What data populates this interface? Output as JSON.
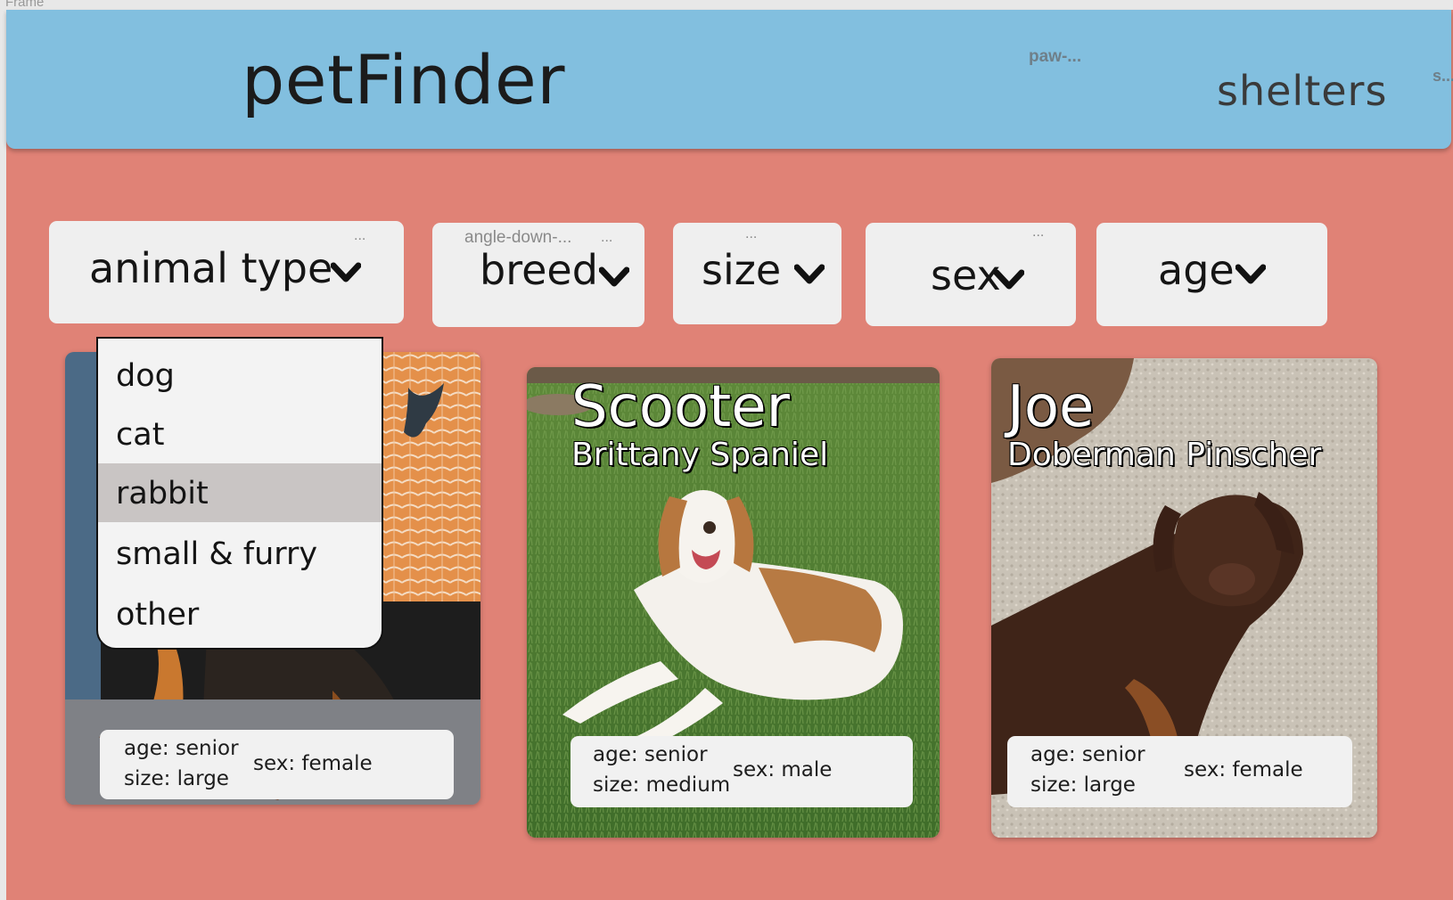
{
  "frame": {
    "label": "Frame"
  },
  "header": {
    "logo": "petFinder",
    "paw_label": "paw-...",
    "nav_shelters": "shelters",
    "s_label": "s..."
  },
  "filters": [
    {
      "label": "animal type",
      "icon": "chevron-down-icon",
      "dots": "...",
      "hint": ""
    },
    {
      "label": "breed",
      "icon": "chevron-down-icon",
      "dots": "...",
      "hint": "angle-down-..."
    },
    {
      "label": "size",
      "icon": "chevron-down-icon",
      "dots": "...",
      "hint": ""
    },
    {
      "label": "sex",
      "icon": "chevron-down-icon",
      "dots": "...",
      "hint": ""
    },
    {
      "label": "age",
      "icon": "chevron-down-icon",
      "dots": "",
      "hint": ""
    }
  ],
  "animal_type_dropdown": {
    "options": [
      "dog",
      "cat",
      "rabbit",
      "small & furry",
      "other"
    ],
    "highlighted": "rabbit"
  },
  "pets": [
    {
      "name": "",
      "breed": "",
      "age": "age: senior",
      "size": "size: large",
      "sex": "sex: female"
    },
    {
      "name": "Scooter",
      "breed": "Brittany Spaniel",
      "age": "age: senior",
      "size": "size: medium",
      "sex": "sex: male"
    },
    {
      "name": "Joe",
      "breed": "Doberman Pinscher",
      "age": "age: senior",
      "size": "size: large",
      "sex": "sex: female"
    }
  ],
  "colors": {
    "page_background": "#e08276",
    "header_background": "#82bfdf",
    "filter_background": "#efefef",
    "dropdown_highlight": "#c9c5c4"
  }
}
